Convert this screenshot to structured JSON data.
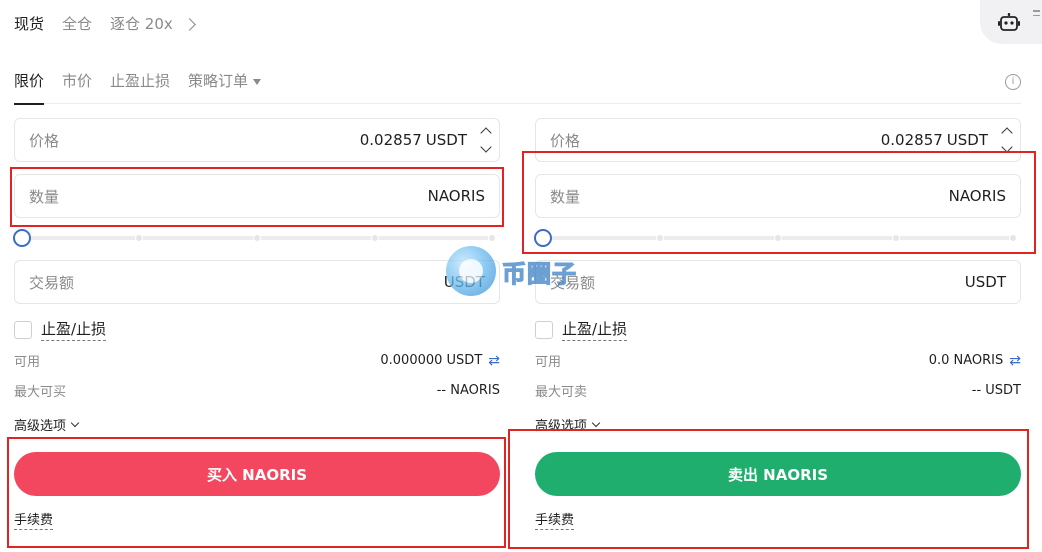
{
  "top_tabs": {
    "spot": "现货",
    "cross": "全仓",
    "isolated": "逐仓 20x"
  },
  "order_tabs": {
    "limit": "限价",
    "market": "市价",
    "tpsl": "止盈止损",
    "strategy": "策略订单"
  },
  "buy": {
    "price_label": "价格",
    "price_value": "0.02857",
    "price_unit": "USDT",
    "qty_label": "数量",
    "qty_unit": "NAORIS",
    "amount_label": "交易额",
    "amount_unit": "USDT",
    "tpsl_label": "止盈/止损",
    "available_label": "可用",
    "available_value": "0.000000 USDT",
    "max_label": "最大可买",
    "max_value": "-- NAORIS",
    "advanced_label": "高级选项",
    "button_label": "买入 NAORIS",
    "fee_label": "手续费"
  },
  "sell": {
    "price_label": "价格",
    "price_value": "0.02857",
    "price_unit": "USDT",
    "qty_label": "数量",
    "qty_unit": "NAORIS",
    "amount_label": "交易额",
    "amount_unit": "USDT",
    "tpsl_label": "止盈/止损",
    "available_label": "可用",
    "available_value": "0.0 NAORIS",
    "max_label": "最大可卖",
    "max_value": "-- USDT",
    "advanced_label": "高级选项",
    "button_label": "卖出 NAORIS",
    "fee_label": "手续费"
  },
  "slider_percent": 0,
  "watermark": "币圈子",
  "colors": {
    "buy": "#f2475f",
    "sell": "#1fae6e",
    "accent": "#3b6cc9",
    "highlight": "#e02323"
  },
  "icons": {
    "robot": "robot-icon",
    "info": "info-icon",
    "swap": "swap-icon"
  }
}
